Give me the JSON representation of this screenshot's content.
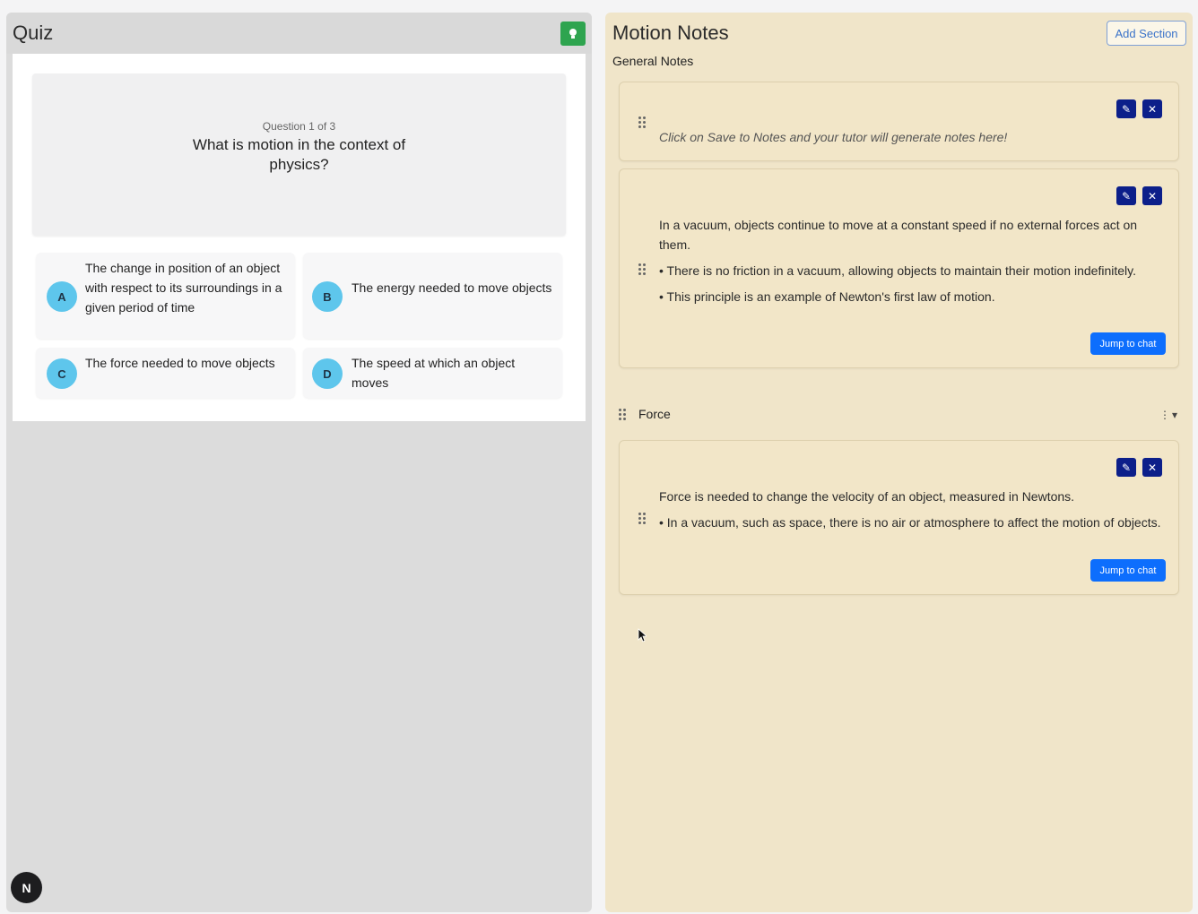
{
  "quiz": {
    "title": "Quiz",
    "hint_icon": "lightbulb-icon",
    "question_counter": "Question 1 of 3",
    "question_text": "What is motion in the context of physics?",
    "answers": [
      {
        "letter": "A",
        "text": "The change in position of an object with respect to its surroundings in a given period of time"
      },
      {
        "letter": "B",
        "text": "The energy needed to move objects"
      },
      {
        "letter": "C",
        "text": "The force needed to move objects"
      },
      {
        "letter": "D",
        "text": "The speed at which an object moves"
      }
    ],
    "avatar_letter": "N"
  },
  "notes": {
    "title": "Motion Notes",
    "add_section_label": "Add Section",
    "general_section_label": "General Notes",
    "cards": [
      {
        "placeholder": "Click on Save to Notes and your tutor will generate notes here!"
      },
      {
        "lines": [
          "In a vacuum, objects continue to move at a constant speed if no external forces act on them.",
          "• There is no friction in a vacuum, allowing objects to maintain their motion indefinitely.",
          "• This principle is an example of Newton's first law of motion."
        ],
        "jump_label": "Jump to chat"
      }
    ],
    "force_section": {
      "label": "Force",
      "card": {
        "lines": [
          "Force is needed to change the velocity of an object, measured in Newtons.",
          "• In a vacuum, such as space, there is no air or atmosphere to affect the motion of objects."
        ],
        "jump_label": "Jump to chat"
      }
    }
  },
  "colors": {
    "hint_green": "#2ea44f",
    "letter_badge": "#5ec6ec",
    "notes_background": "#f0e5c9",
    "action_navy": "#0c1f8a",
    "jump_blue": "#0d6efd"
  }
}
